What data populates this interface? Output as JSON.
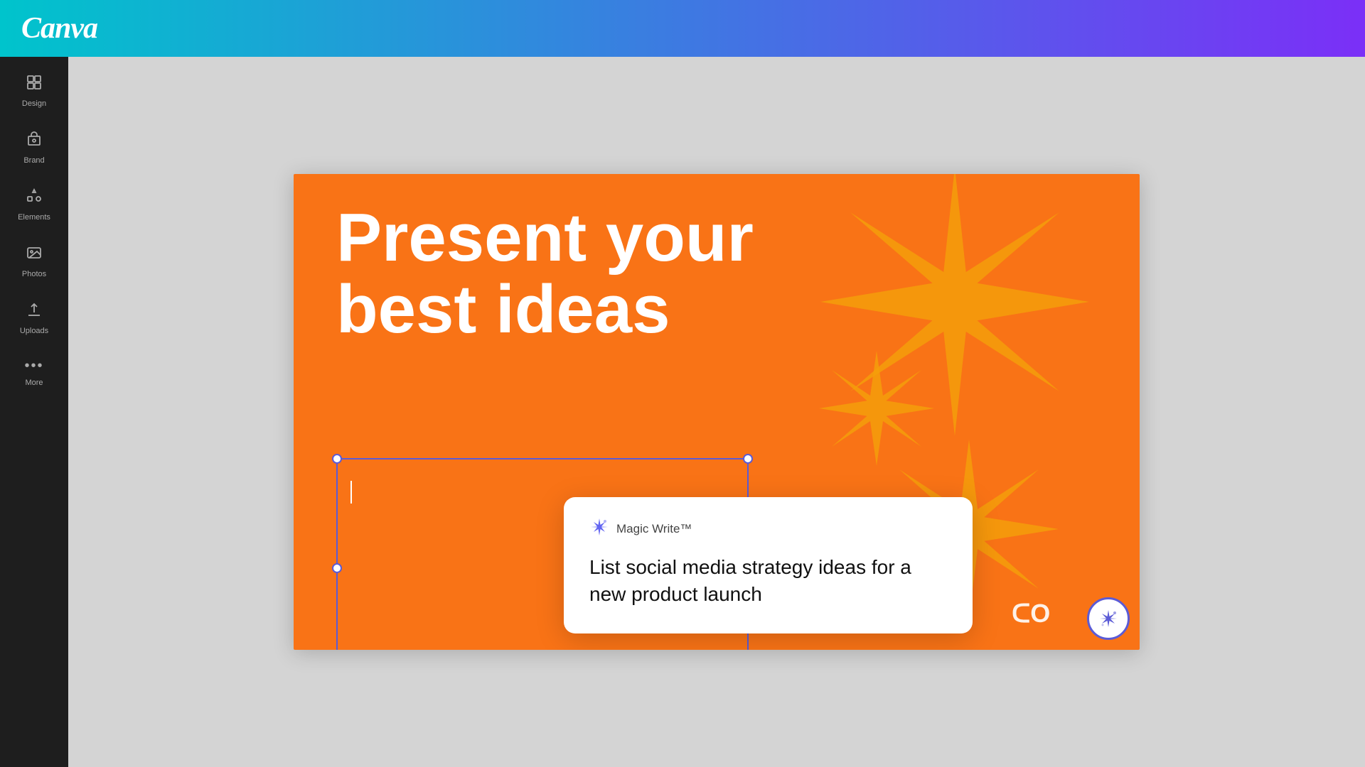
{
  "header": {
    "logo": "Canva"
  },
  "sidebar": {
    "items": [
      {
        "id": "design",
        "label": "Design",
        "icon": "⊞"
      },
      {
        "id": "brand",
        "label": "Brand",
        "icon": "🏷"
      },
      {
        "id": "elements",
        "label": "Elements",
        "icon": "✦"
      },
      {
        "id": "photos",
        "label": "Photos",
        "icon": "🖼"
      },
      {
        "id": "uploads",
        "label": "Uploads",
        "icon": "⬆"
      },
      {
        "id": "more",
        "label": "More",
        "icon": "···"
      }
    ]
  },
  "canvas": {
    "heading_line1": "Present your",
    "heading_line2": "best ideas",
    "background_color": "#f97316"
  },
  "magic_write": {
    "title": "Magic Write™",
    "prompt": "List social media strategy ideas for a new product launch"
  },
  "canvas_logo": "ᑕO",
  "magic_button_icon": "✦"
}
